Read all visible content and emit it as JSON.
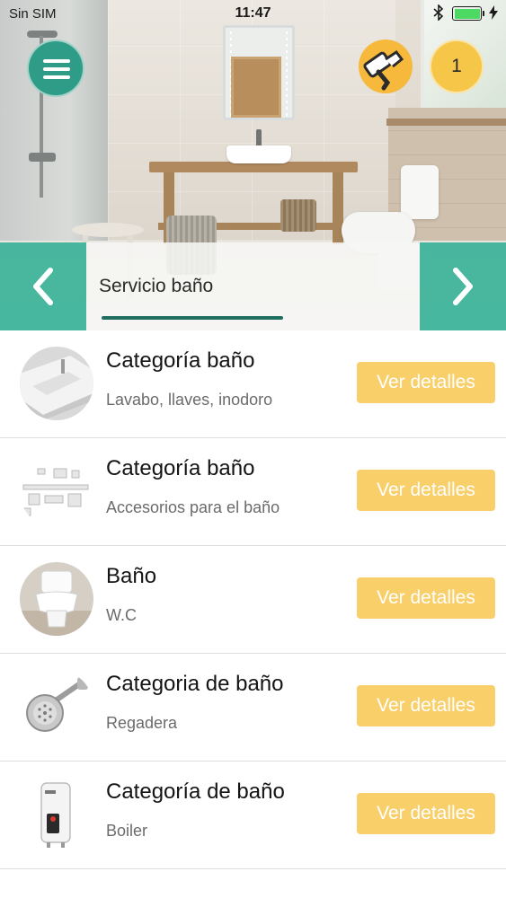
{
  "status_bar": {
    "carrier": "Sin SIM",
    "time": "11:47",
    "battery_percent": 100,
    "icons": [
      "bluetooth-icon",
      "battery-icon",
      "charging-bolt-icon"
    ]
  },
  "header": {
    "menu_icon": "hamburger-menu-icon",
    "service_icon": "paint-roller-icon",
    "cart_count": "1"
  },
  "tabs": {
    "active_label": "Servicio baño",
    "prev_icon": "chevron-left-icon",
    "next_icon": "chevron-right-icon"
  },
  "items": [
    {
      "title": "Categoría baño",
      "subtitle": "Lavabo, llaves, inodoro",
      "button": "Ver detalles",
      "image": "washbasin"
    },
    {
      "title": "Categoría baño",
      "subtitle": "Accesorios para el baño",
      "button": "Ver detalles",
      "image": "bath-accessories"
    },
    {
      "title": "Baño",
      "subtitle": "W.C",
      "button": "Ver detalles",
      "image": "toilet"
    },
    {
      "title": "Categoria de baño",
      "subtitle": "Regadera",
      "button": "Ver detalles",
      "image": "shower-head"
    },
    {
      "title": "Categoría de baño",
      "subtitle": "Boiler",
      "button": "Ver detalles",
      "image": "water-heater"
    }
  ],
  "colors": {
    "primary_green": "#2e9c86",
    "arrow_green": "#3ab298",
    "accent_yellow": "#f6c649",
    "button_yellow": "#f9cf6a",
    "tab_underline": "#1f6e5f"
  }
}
